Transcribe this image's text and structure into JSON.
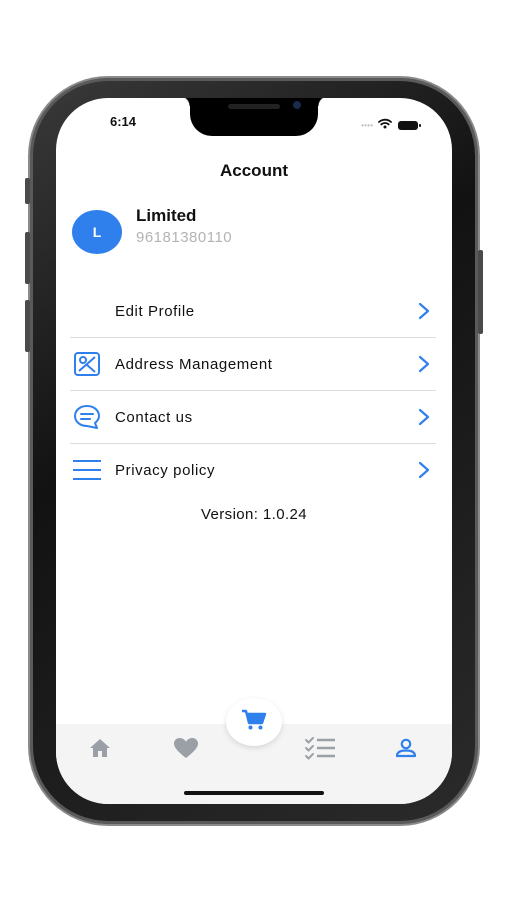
{
  "status_bar": {
    "time": "6:14"
  },
  "header": {
    "title": "Account"
  },
  "profile": {
    "avatar_initial": "L",
    "name": "Limited",
    "phone": "96181380110"
  },
  "menu": {
    "items": [
      {
        "label": "Edit Profile",
        "icon": "none"
      },
      {
        "label": "Address Management",
        "icon": "map-icon"
      },
      {
        "label": "Contact us",
        "icon": "chat-icon"
      },
      {
        "label": "Privacy policy",
        "icon": "menu-lines-icon"
      }
    ]
  },
  "version_text": "Version: 1.0.24",
  "tabbar": {
    "tabs": [
      {
        "icon": "home-icon",
        "active": false
      },
      {
        "icon": "heart-icon",
        "active": false
      },
      {
        "icon": "cart-icon",
        "active": false
      },
      {
        "icon": "checklist-icon",
        "active": false
      },
      {
        "icon": "user-icon",
        "active": true
      }
    ]
  },
  "colors": {
    "accent": "#2f80ed",
    "inactive_tab": "#9aa0a6",
    "divider": "#dcdcdc",
    "subtext": "#b3b3b3"
  }
}
